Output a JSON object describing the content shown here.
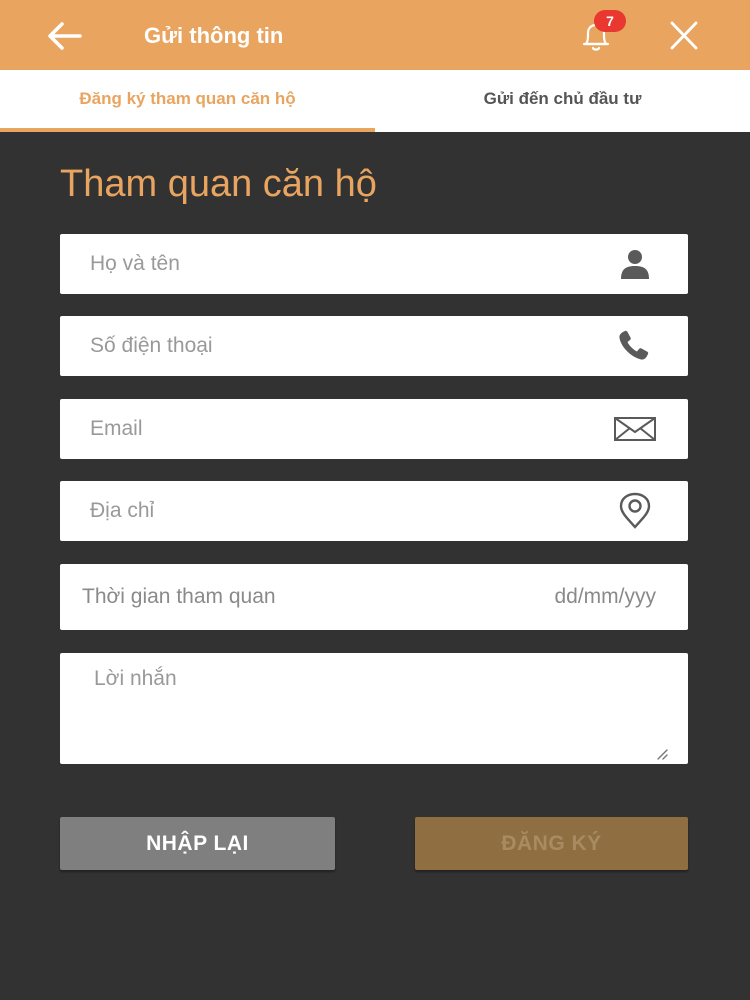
{
  "header": {
    "title": "Gửi thông tin",
    "notification_count": "7",
    "icons": {
      "back": "arrow-left-icon",
      "bell": "bell-icon",
      "close": "close-icon"
    }
  },
  "tabs": [
    {
      "label": "Đăng ký tham quan căn hộ",
      "active": true
    },
    {
      "label": "Gửi đến chủ đầu tư",
      "active": false
    }
  ],
  "form": {
    "title": "Tham quan căn hộ",
    "fields": {
      "name": {
        "placeholder": "Họ và tên",
        "value": "",
        "icon": "user-icon"
      },
      "phone": {
        "placeholder": "Số điện thoại",
        "value": "",
        "icon": "phone-icon"
      },
      "email": {
        "placeholder": "Email",
        "value": "",
        "icon": "envelope-icon"
      },
      "address": {
        "placeholder": "Địa chỉ",
        "value": "",
        "icon": "location-pin-icon"
      },
      "visit_time": {
        "label": "Thời gian tham quan",
        "format": "dd/mm/yyy"
      },
      "message": {
        "placeholder": "Lời nhắn",
        "value": ""
      }
    },
    "buttons": {
      "reset": "NHẬP LẠI",
      "submit": "ĐĂNG KÝ"
    }
  },
  "colors": {
    "accent": "#E9A55F",
    "background": "#323233",
    "badge": "#E8382F",
    "reset_button": "#7F7F80",
    "submit_button_disabled": "#8F6E41"
  }
}
